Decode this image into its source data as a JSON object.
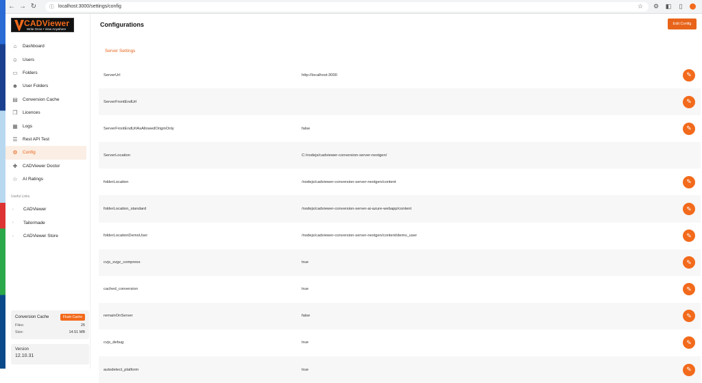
{
  "browser": {
    "url": "localhost:3000/settings/config"
  },
  "sidebar": {
    "logo_text": "CADViewer",
    "logo_tagline": "Write Once • View Anywhere",
    "items": [
      {
        "label": "Dashboard",
        "icon": "home-icon"
      },
      {
        "label": "Users",
        "icon": "users-icon"
      },
      {
        "label": "Folders",
        "icon": "folder-icon"
      },
      {
        "label": "User Folders",
        "icon": "user-folder-icon"
      },
      {
        "label": "Conversion Cache",
        "icon": "cache-icon"
      },
      {
        "label": "Licences",
        "icon": "license-icon"
      },
      {
        "label": "Logs",
        "icon": "logs-icon"
      },
      {
        "label": "Rest API Test",
        "icon": "api-icon"
      },
      {
        "label": "Config",
        "icon": "gear-icon"
      },
      {
        "label": "CADViewer Doctor",
        "icon": "doctor-icon"
      },
      {
        "label": "AI Ratings",
        "icon": "star-icon"
      }
    ],
    "useful_links_title": "Useful Links",
    "useful_links": [
      {
        "label": "CADViewer"
      },
      {
        "label": "Tailormade"
      },
      {
        "label": "CADViewer Store"
      }
    ],
    "cache": {
      "title": "Conversion Cache",
      "flush_label": "Flush Cache",
      "files_label": "Files:",
      "files_value": "25",
      "size_label": "Size:",
      "size_value": "14.51 MB"
    },
    "version": {
      "label": "Version",
      "value": "12.10.31"
    }
  },
  "main": {
    "title": "Configurations",
    "edit_config_label": "Edit Config",
    "section_title": "Server Settings",
    "rows": [
      {
        "key": "ServerUrl",
        "value": "http://localhost:3000",
        "editable": true
      },
      {
        "key": "ServerFrontEndUrl",
        "value": "",
        "editable": true
      },
      {
        "key": "ServerFrontEndUrlAsAllowedOriginOnly",
        "value": "false",
        "editable": true
      },
      {
        "key": "ServerLocation",
        "value": "C:/nodejs/cadviewer-conversion-server-nextgen/",
        "editable": false
      },
      {
        "key": "folderLocation",
        "value": "/nodejs/cadviewer-conversion-server-nextgen/content",
        "editable": true
      },
      {
        "key": "folderLocation_standard",
        "value": "/nodejs/cadviewer-conversion-server-ai-azure-webapp/content",
        "editable": true
      },
      {
        "key": "folderLocationDemoUser",
        "value": "/nodejs/cadviewer-conversion-server-nextgen/content/demo_user",
        "editable": true
      },
      {
        "key": "cvjs_svgz_compress",
        "value": "true",
        "editable": true
      },
      {
        "key": "cached_conversion",
        "value": "true",
        "editable": true
      },
      {
        "key": "remainOnServer",
        "value": "false",
        "editable": true
      },
      {
        "key": "cvjs_debug",
        "value": "true",
        "editable": true
      },
      {
        "key": "autodetect_platform",
        "value": "true",
        "editable": true
      }
    ]
  },
  "colors": {
    "accent": "#f26a1b",
    "active_bg": "#fbeee4"
  }
}
